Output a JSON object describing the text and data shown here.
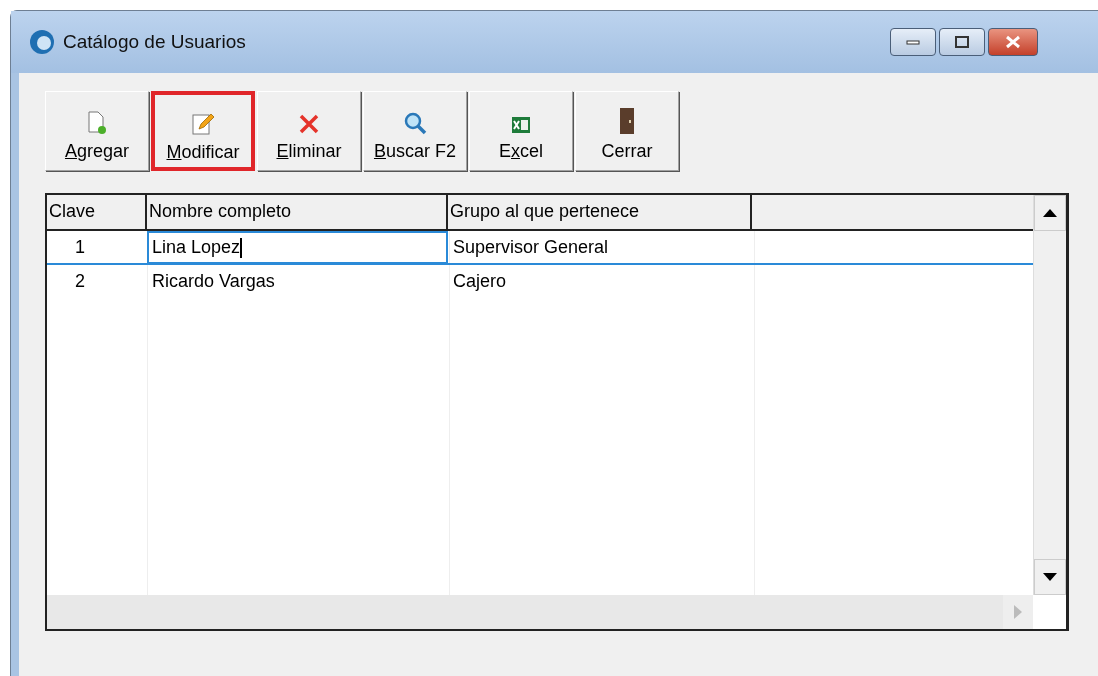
{
  "window": {
    "title": "Catálogo de Usuarios"
  },
  "toolbar": [
    {
      "kind": "add",
      "label_parts": [
        {
          "text": "A",
          "underlined": true
        },
        {
          "text": "gregar",
          "underlined": false
        }
      ],
      "highlighted": false
    },
    {
      "kind": "edit",
      "label_parts": [
        {
          "text": "M",
          "underlined": true
        },
        {
          "text": "odificar",
          "underlined": false
        }
      ],
      "highlighted": true
    },
    {
      "kind": "delete",
      "label_parts": [
        {
          "text": "E",
          "underlined": true
        },
        {
          "text": "liminar",
          "underlined": false
        }
      ],
      "highlighted": false
    },
    {
      "kind": "search",
      "label_parts": [
        {
          "text": "B",
          "underlined": true
        },
        {
          "text": "uscar F2",
          "underlined": false
        }
      ],
      "highlighted": false
    },
    {
      "kind": "excel",
      "label_parts": [
        {
          "text": "E",
          "underlined": false
        },
        {
          "text": "x",
          "underlined": true
        },
        {
          "text": "cel",
          "underlined": false
        }
      ],
      "highlighted": false
    },
    {
      "kind": "close",
      "label_parts": [
        {
          "text": "Cerrar",
          "underlined": false
        }
      ],
      "highlighted": false
    }
  ],
  "table": {
    "columns": [
      "Clave",
      "Nombre completo",
      "Grupo al que pertenece"
    ],
    "rows": [
      {
        "cells": [
          "1",
          "Lina Lopez",
          "Supervisor General"
        ],
        "selected": true,
        "editing": true
      },
      {
        "cells": [
          "2",
          "Ricardo Vargas",
          "Cajero"
        ],
        "selected": false,
        "editing": false
      }
    ]
  }
}
